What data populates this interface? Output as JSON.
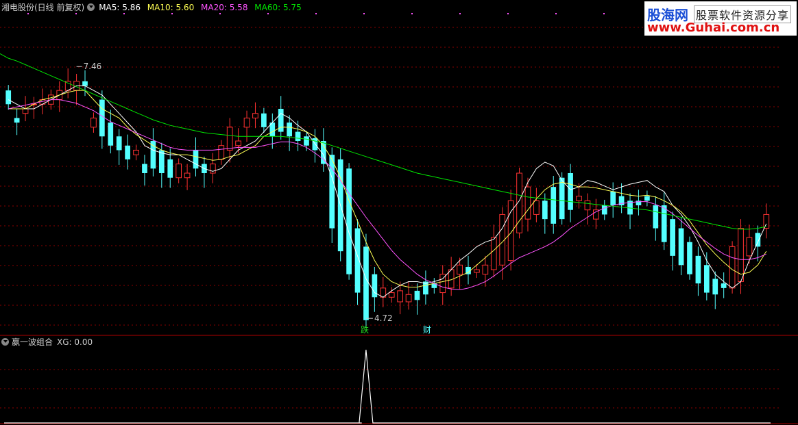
{
  "main_header": {
    "stock_title": "湘电股份(日线 前复权)",
    "ma5_label": "MA5: 5.86",
    "ma10_label": "MA10: 5.60",
    "ma20_label": "MA20: 5.58",
    "ma60_label": "MA60: 5.75"
  },
  "sub_header": {
    "indicator_name": "赢一波组合",
    "xg_label": "XG: 0.00"
  },
  "logo": {
    "line1": "股海网",
    "line2": "股票软件资源分享",
    "line3": "www.Guhai.com.cn"
  },
  "markers": {
    "high_label": "7.46",
    "low_label": "4.72",
    "signal_die": "跌",
    "signal_cai": "财"
  },
  "colors": {
    "up": "#ff3232",
    "down": "#54ffff",
    "ma5": "#ffffff",
    "ma10": "#ffff54",
    "ma20": "#ff54ff",
    "ma60": "#00e600",
    "grid": "#8b0000",
    "xg_line": "#ffffff",
    "die_text": "#22dd22",
    "cai_text": "#54ffff"
  },
  "chart_data": [
    {
      "type": "candlestick",
      "y_range": [
        4.55,
        8.05
      ],
      "series": [
        {
          "name": "MA5",
          "values": [
            7.1,
            7.05,
            7.0,
            7.0,
            7.05,
            7.1,
            7.15,
            7.2,
            7.25,
            7.25,
            7.2,
            7.15,
            7.05,
            6.95,
            6.85,
            6.75,
            6.6,
            6.55,
            6.52,
            6.5,
            6.5,
            6.45,
            6.4,
            6.35,
            6.32,
            6.35,
            6.45,
            6.55,
            6.6,
            6.65,
            6.75,
            6.85,
            6.95,
            6.9,
            6.82,
            6.75,
            6.62,
            6.5,
            6.25,
            5.95,
            5.65,
            5.4,
            5.15,
            5.0,
            4.95,
            5.02,
            5.08,
            5.12,
            5.12,
            5.1,
            5.12,
            5.15,
            5.25,
            5.35,
            5.42,
            5.5,
            5.55,
            5.58,
            5.7,
            5.88,
            6.0,
            6.2,
            6.35,
            6.42,
            6.38,
            6.22,
            6.12,
            6.15,
            6.22,
            6.2,
            6.16,
            6.12,
            6.15,
            6.18,
            6.2,
            6.22,
            6.15,
            6.1,
            5.95,
            5.85,
            5.72,
            5.55,
            5.35,
            5.2,
            5.12,
            5.05,
            5.12,
            5.35,
            5.55,
            5.75
          ]
        },
        {
          "name": "MA10",
          "values": [
            7.0,
            7.0,
            7.0,
            7.05,
            7.1,
            7.12,
            7.15,
            7.18,
            7.2,
            7.2,
            7.1,
            7.0,
            6.95,
            6.9,
            6.8,
            6.72,
            6.66,
            6.6,
            6.55,
            6.52,
            6.5,
            6.5,
            6.48,
            6.46,
            6.44,
            6.45,
            6.48,
            6.5,
            6.55,
            6.6,
            6.7,
            6.75,
            6.8,
            6.8,
            6.78,
            6.75,
            6.7,
            6.6,
            6.45,
            6.25,
            6.0,
            5.78,
            5.55,
            5.35,
            5.2,
            5.12,
            5.08,
            5.06,
            5.06,
            5.08,
            5.1,
            5.12,
            5.14,
            5.18,
            5.22,
            5.3,
            5.38,
            5.46,
            5.55,
            5.65,
            5.78,
            5.9,
            6.02,
            6.12,
            6.18,
            6.2,
            6.18,
            6.15,
            6.15,
            6.14,
            6.12,
            6.1,
            6.08,
            6.06,
            6.05,
            6.06,
            6.04,
            6.0,
            5.95,
            5.88,
            5.78,
            5.65,
            5.52,
            5.42,
            5.33,
            5.25,
            5.2,
            5.22,
            5.3,
            5.45
          ]
        },
        {
          "name": "MA20",
          "values": [
            7.0,
            7.02,
            7.04,
            7.06,
            7.08,
            7.1,
            7.1,
            7.08,
            7.06,
            7.02,
            6.98,
            6.92,
            6.86,
            6.82,
            6.78,
            6.74,
            6.7,
            6.66,
            6.62,
            6.58,
            6.56,
            6.55,
            6.55,
            6.55,
            6.55,
            6.56,
            6.57,
            6.58,
            6.58,
            6.58,
            6.6,
            6.62,
            6.64,
            6.64,
            6.62,
            6.58,
            6.52,
            6.45,
            6.35,
            6.22,
            6.08,
            5.95,
            5.82,
            5.7,
            5.58,
            5.46,
            5.36,
            5.28,
            5.2,
            5.14,
            5.1,
            5.06,
            5.04,
            5.03,
            5.05,
            5.08,
            5.12,
            5.18,
            5.25,
            5.32,
            5.38,
            5.42,
            5.46,
            5.5,
            5.55,
            5.62,
            5.7,
            5.76,
            5.82,
            5.88,
            5.92,
            5.95,
            5.97,
            5.98,
            5.99,
            5.99,
            5.96,
            5.92,
            5.86,
            5.78,
            5.7,
            5.62,
            5.55,
            5.48,
            5.42,
            5.38,
            5.36,
            5.36,
            5.38,
            5.42
          ]
        },
        {
          "name": "MA60",
          "values": [
            7.55,
            7.52,
            7.48,
            7.44,
            7.4,
            7.36,
            7.32,
            7.28,
            7.24,
            7.2,
            7.16,
            7.12,
            7.08,
            7.04,
            7.0,
            6.96,
            6.92,
            6.88,
            6.85,
            6.82,
            6.8,
            6.78,
            6.76,
            6.74,
            6.73,
            6.72,
            6.71,
            6.7,
            6.7,
            6.7,
            6.7,
            6.7,
            6.7,
            6.69,
            6.68,
            6.67,
            6.65,
            6.63,
            6.6,
            6.57,
            6.54,
            6.51,
            6.48,
            6.45,
            6.42,
            6.39,
            6.36,
            6.33,
            6.3,
            6.28,
            6.26,
            6.24,
            6.22,
            6.2,
            6.18,
            6.16,
            6.14,
            6.12,
            6.1,
            6.08,
            6.06,
            6.04,
            6.03,
            6.02,
            6.01,
            6.0,
            5.99,
            5.98,
            5.97,
            5.96,
            5.95,
            5.94,
            5.93,
            5.92,
            5.91,
            5.9,
            5.88,
            5.86,
            5.84,
            5.82,
            5.8,
            5.78,
            5.76,
            5.74,
            5.72,
            5.7,
            5.69,
            5.69,
            5.7,
            5.72
          ]
        }
      ],
      "candles": {
        "open": [
          7.2,
          6.9,
          6.95,
          7.05,
          7.05,
          7.05,
          7.1,
          7.2,
          7.2,
          7.3,
          6.8,
          7.1,
          6.85,
          6.7,
          6.6,
          6.5,
          6.4,
          6.65,
          6.55,
          6.45,
          6.25,
          6.25,
          6.55,
          6.4,
          6.3,
          6.45,
          6.55,
          6.6,
          6.8,
          6.9,
          6.95,
          6.85,
          7.0,
          6.85,
          6.75,
          6.7,
          6.68,
          6.65,
          6.5,
          6.45,
          6.35,
          5.7,
          5.5,
          5.2,
          4.95,
          4.95,
          4.9,
          4.9,
          5.02,
          5.12,
          5.1,
          5.0,
          5.05,
          5.2,
          5.28,
          5.22,
          5.2,
          5.25,
          5.3,
          5.35,
          5.65,
          5.8,
          5.85,
          6.0,
          6.15,
          6.25,
          6.3,
          6.0,
          5.9,
          5.8,
          5.95,
          6.1,
          6.05,
          6.0,
          6.0,
          6.05,
          5.95,
          5.95,
          5.8,
          5.7,
          5.55,
          5.4,
          5.3,
          5.15,
          5.1,
          5.05,
          5.12,
          5.4,
          5.65,
          5.7
        ],
        "close": [
          7.05,
          6.85,
          7.0,
          7.05,
          7.1,
          7.15,
          7.2,
          7.3,
          7.3,
          7.25,
          6.9,
          6.7,
          6.6,
          6.55,
          6.45,
          6.55,
          6.3,
          6.35,
          6.3,
          6.25,
          6.4,
          6.3,
          6.35,
          6.3,
          6.4,
          6.6,
          6.8,
          6.65,
          6.9,
          6.95,
          6.8,
          6.7,
          6.75,
          6.7,
          6.65,
          6.6,
          6.55,
          6.4,
          5.7,
          5.45,
          5.2,
          5.0,
          4.7,
          4.95,
          5.05,
          5.0,
          5.02,
          4.98,
          4.92,
          4.98,
          5.05,
          5.2,
          5.25,
          5.3,
          5.2,
          5.25,
          5.3,
          5.6,
          5.85,
          6.0,
          6.3,
          6.15,
          6.0,
          5.8,
          5.75,
          5.8,
          5.9,
          6.05,
          6.0,
          5.9,
          5.85,
          5.95,
          5.95,
          5.85,
          5.95,
          6.0,
          5.7,
          5.55,
          5.4,
          5.3,
          5.2,
          5.1,
          5.0,
          4.98,
          5.05,
          5.5,
          5.7,
          5.6,
          5.5,
          5.85
        ]
      },
      "annotations": [
        {
          "text": "7.46",
          "candle_index": 8,
          "price": 7.46
        },
        {
          "text": "4.72",
          "candle_index": 42,
          "price": 4.72
        }
      ]
    },
    {
      "type": "line",
      "series": [
        {
          "name": "XG",
          "values": [
            0,
            0,
            0,
            0,
            0,
            0,
            0,
            0,
            0,
            0,
            0,
            0,
            0,
            0,
            0,
            0,
            0,
            0,
            0,
            0,
            0,
            0,
            0,
            0,
            0,
            0,
            0,
            0,
            0,
            0,
            0,
            0,
            0,
            0,
            0,
            0,
            0,
            0,
            0,
            0,
            0,
            0,
            1,
            0,
            0,
            0,
            0,
            0,
            0,
            0,
            0,
            0,
            0,
            0,
            0,
            0,
            0,
            0,
            0,
            0,
            0,
            0,
            0,
            0,
            0,
            0,
            0,
            0,
            0,
            0,
            0,
            0,
            0,
            0,
            0,
            0,
            0,
            0,
            0,
            0,
            0,
            0,
            0,
            0,
            0,
            0,
            0,
            0,
            0,
            0
          ]
        }
      ],
      "y_range": [
        0,
        1
      ]
    }
  ]
}
